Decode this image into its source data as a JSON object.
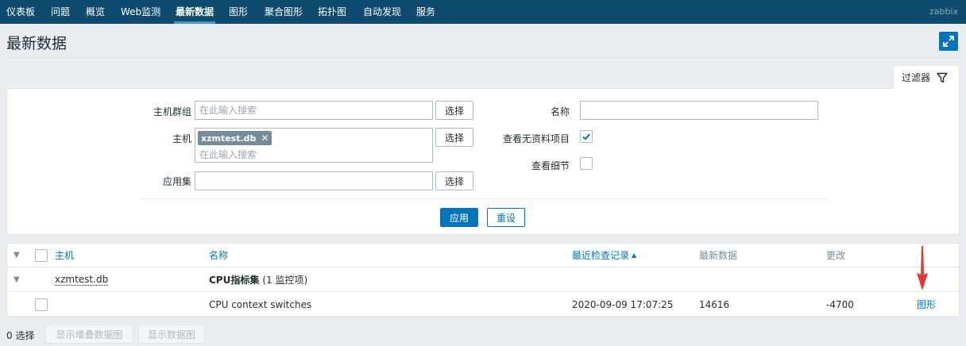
{
  "nav": {
    "items": [
      "仪表板",
      "问题",
      "概览",
      "Web监测",
      "最新数据",
      "图形",
      "聚合图形",
      "拓扑图",
      "自动发现",
      "服务"
    ],
    "brand": "zabbix"
  },
  "page": {
    "title": "最新数据"
  },
  "filter": {
    "tab_label": "过滤器",
    "host_groups": {
      "label": "主机群组",
      "placeholder": "在此输入搜索",
      "select_label": "选择"
    },
    "hosts": {
      "label": "主机",
      "tag": "xzmtest.db",
      "placeholder": "在此输入搜索",
      "select_label": "选择"
    },
    "application": {
      "label": "应用集",
      "value": "",
      "select_label": "选择"
    },
    "name": {
      "label": "名称",
      "value": ""
    },
    "show_without_data": {
      "label": "查看无资料项目",
      "checked": true
    },
    "show_details": {
      "label": "查看细节",
      "checked": false
    },
    "apply_label": "应用",
    "reset_label": "重设"
  },
  "table": {
    "headers": {
      "host": "主机",
      "name": "名称",
      "last_check": "最近检查记录",
      "last_value": "最新数据",
      "change": "更改"
    },
    "group": {
      "host": "xzmtest.db",
      "application": "CPU指标集",
      "count": "(1 监控项)"
    },
    "items": [
      {
        "name": "CPU context switches",
        "last_check": "2020-09-09 17:07:25",
        "last_value": "14616",
        "change": "-4700",
        "action": "图形"
      }
    ]
  },
  "footer": {
    "selected": "0 选择",
    "stacked_graph": "显示堆叠数据图",
    "graph": "显示数据图"
  },
  "colors": {
    "nav_bg": "#0e4b6e",
    "accent": "#0275b8",
    "annotation_arrow": "#e33734"
  }
}
